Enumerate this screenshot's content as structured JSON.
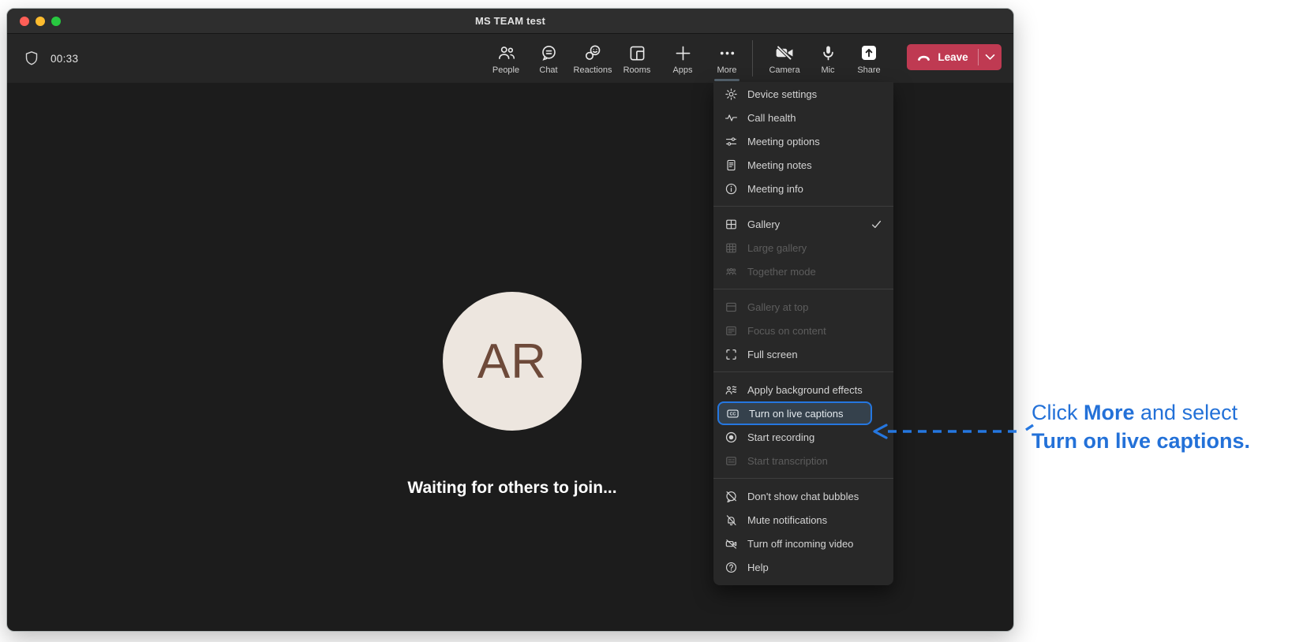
{
  "window": {
    "title": "MS TEAM test"
  },
  "titlebar_buttons": {
    "close": "close-button",
    "minimize": "minimize-button",
    "zoom": "zoom-button"
  },
  "toolbar": {
    "timer": "00:33",
    "buttons": [
      {
        "label": "People",
        "icon": "people-icon"
      },
      {
        "label": "Chat",
        "icon": "chat-icon"
      },
      {
        "label": "Reactions",
        "icon": "reactions-icon"
      },
      {
        "label": "Rooms",
        "icon": "rooms-icon"
      },
      {
        "label": "Apps",
        "icon": "plus-icon"
      },
      {
        "label": "More",
        "icon": "ellipsis-icon"
      }
    ],
    "device_buttons": [
      {
        "label": "Camera",
        "icon": "camera-off-icon"
      },
      {
        "label": "Mic",
        "icon": "mic-icon"
      },
      {
        "label": "Share",
        "icon": "share-icon"
      }
    ],
    "leave_label": "Leave"
  },
  "stage": {
    "avatar_initials": "AR",
    "waiting_text": "Waiting for others to join..."
  },
  "menu": {
    "sections": [
      {
        "items": [
          {
            "label": "Device settings",
            "icon": "gear-icon"
          },
          {
            "label": "Call health",
            "icon": "pulse-icon"
          },
          {
            "label": "Meeting options",
            "icon": "sliders-icon"
          },
          {
            "label": "Meeting notes",
            "icon": "note-icon"
          },
          {
            "label": "Meeting info",
            "icon": "info-icon"
          }
        ]
      },
      {
        "items": [
          {
            "label": "Gallery",
            "icon": "grid-2x2-icon",
            "checked": true
          },
          {
            "label": "Large gallery",
            "icon": "grid-3x3-icon",
            "disabled": true
          },
          {
            "label": "Together mode",
            "icon": "together-mode-icon",
            "disabled": true
          }
        ]
      },
      {
        "items": [
          {
            "label": "Gallery at top",
            "icon": "gallery-top-icon",
            "disabled": true
          },
          {
            "label": "Focus on content",
            "icon": "focus-content-icon",
            "disabled": true
          },
          {
            "label": "Full screen",
            "icon": "fullscreen-icon"
          }
        ]
      },
      {
        "items": [
          {
            "label": "Apply background effects",
            "icon": "background-effects-icon"
          },
          {
            "label": "Turn on live captions",
            "icon": "cc-icon",
            "highlighted": true
          },
          {
            "label": "Start recording",
            "icon": "record-icon"
          },
          {
            "label": "Start transcription",
            "icon": "transcript-icon",
            "disabled": true
          }
        ]
      },
      {
        "items": [
          {
            "label": "Don't show chat bubbles",
            "icon": "chat-slash-icon"
          },
          {
            "label": "Mute notifications",
            "icon": "bell-slash-icon"
          },
          {
            "label": "Turn off incoming video",
            "icon": "camera-slash-icon"
          },
          {
            "label": "Help",
            "icon": "help-icon"
          }
        ]
      }
    ]
  },
  "annotation": {
    "line1_prefix": "Click ",
    "line1_bold": "More",
    "line1_suffix": " and select",
    "line2_bold": "Turn on live captions."
  },
  "colors": {
    "accent_highlight": "#2577E0",
    "annotation_text": "#2371D8",
    "leave_button": "#BF3A52",
    "avatar_background": "#EDE6DF",
    "avatar_text": "#6E4A3A",
    "traffic_close": "#FF5F57",
    "traffic_minimize": "#FEBC2E",
    "traffic_zoom": "#28C840"
  }
}
